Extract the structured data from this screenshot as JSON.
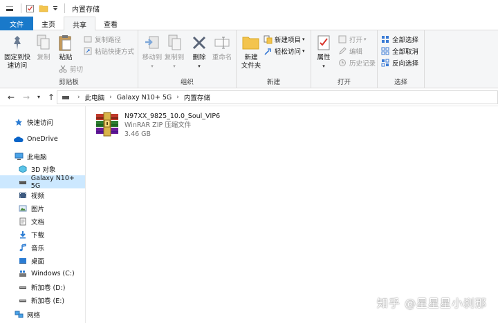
{
  "window": {
    "title": "内置存储"
  },
  "tabs": [
    {
      "label": "文件"
    },
    {
      "label": "主页"
    },
    {
      "label": "共享"
    },
    {
      "label": "查看"
    }
  ],
  "ribbon": {
    "clipboard": {
      "group_label": "剪贴板",
      "pin_label_1": "固定到快",
      "pin_label_2": "速访问",
      "copy": "复制",
      "paste": "粘贴",
      "copy_path": "复制路径",
      "paste_shortcut": "粘贴快捷方式",
      "cut": "剪切"
    },
    "organize": {
      "group_label": "组织",
      "move_to": "移动到",
      "copy_to": "复制到",
      "delete": "删除",
      "rename": "重命名"
    },
    "new": {
      "group_label": "新建",
      "new_folder_1": "新建",
      "new_folder_2": "文件夹",
      "new_item": "新建项目",
      "easy_access": "轻松访问"
    },
    "open": {
      "group_label": "打开",
      "properties": "属性",
      "open": "打开",
      "edit": "编辑",
      "history": "历史记录"
    },
    "select": {
      "group_label": "选择",
      "select_all": "全部选择",
      "select_none": "全部取消",
      "invert": "反向选择"
    }
  },
  "address": {
    "crumbs": [
      "此电脑",
      "Galaxy N10+ 5G",
      "内置存储"
    ]
  },
  "sidebar": {
    "items": [
      {
        "label": "快速访问"
      },
      {
        "label": "OneDrive"
      },
      {
        "label": "此电脑"
      },
      {
        "label": "3D 对象"
      },
      {
        "label": "Galaxy N10+ 5G"
      },
      {
        "label": "视频"
      },
      {
        "label": "图片"
      },
      {
        "label": "文档"
      },
      {
        "label": "下载"
      },
      {
        "label": "音乐"
      },
      {
        "label": "桌面"
      },
      {
        "label": "Windows (C:)"
      },
      {
        "label": "新加卷 (D:)"
      },
      {
        "label": "新加卷 (E:)"
      },
      {
        "label": "网络"
      }
    ]
  },
  "files": [
    {
      "name": "N97XX_9825_10.0_Soul_VIP6",
      "type": "WinRAR ZIP 压缩文件",
      "size": "3.46 GB",
      "icon": "winrar-archive-icon"
    }
  ],
  "watermark": "知乎 @星星星小刹那",
  "colors": {
    "accent": "#1979ca",
    "selected": "#cce8ff",
    "ribbon_bg": "#f5f6f7"
  }
}
